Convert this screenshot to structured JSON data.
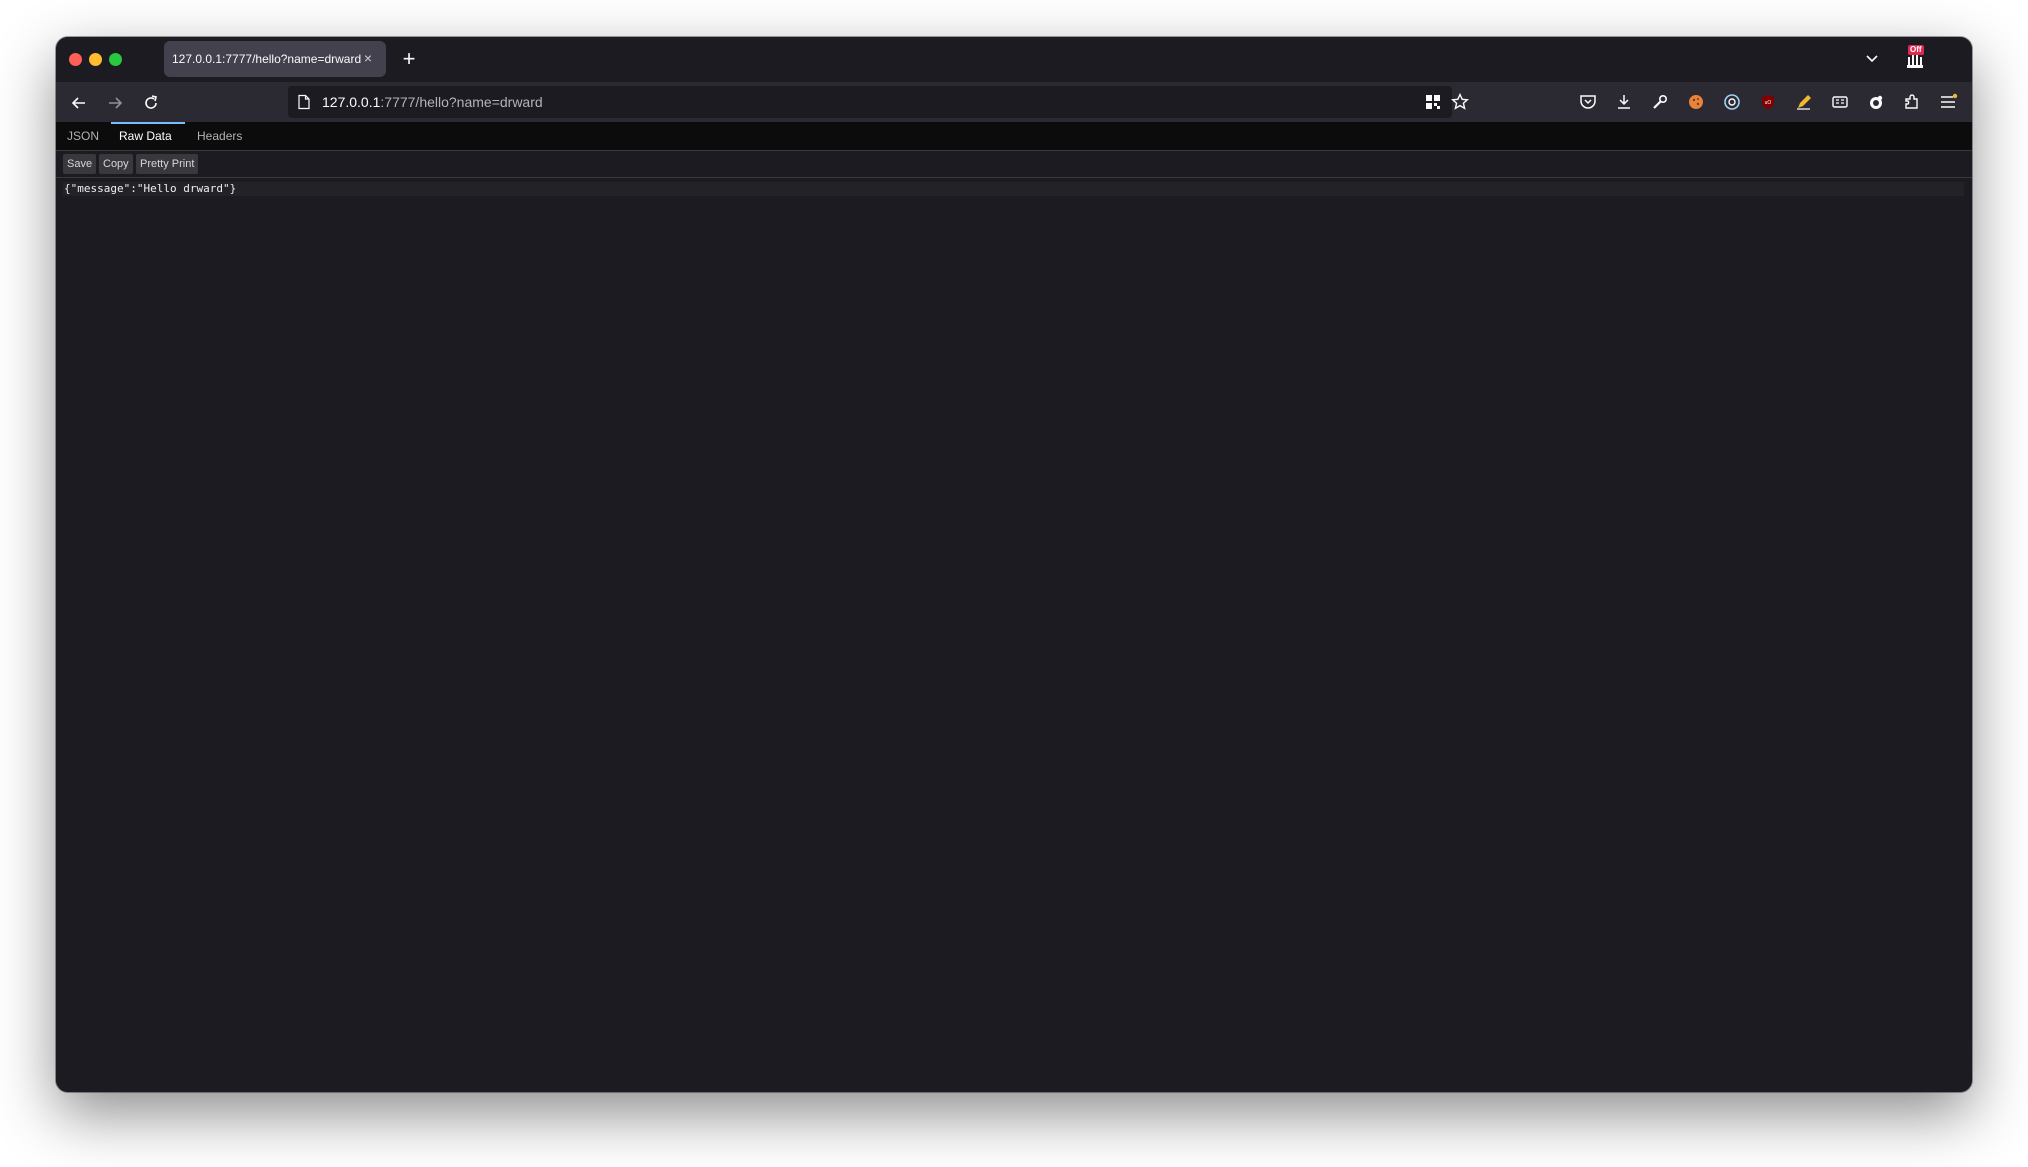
{
  "browser": {
    "tab": {
      "title": "127.0.0.1:7777/hello?name=drward",
      "close_glyph": "×"
    },
    "new_tab_glyph": "+",
    "extension_badge": "Off",
    "url": {
      "host": "127.0.0.1",
      "rest": ":7777/hello?name=drward"
    },
    "icons": [
      "back-icon",
      "forward-icon",
      "reload-icon",
      "page-icon",
      "qr-code-icon",
      "bookmark-star-icon",
      "pocket-icon",
      "downloads-icon",
      "wrench-icon",
      "cookie-icon",
      "globe-icon",
      "ublock-icon",
      "pen-icon",
      "reader-icon",
      "extension-circle-icon",
      "extensions-icon",
      "menu-icon",
      "chevron-down-icon"
    ]
  },
  "viewer": {
    "tabs": [
      {
        "label": "JSON"
      },
      {
        "label": "Raw Data"
      },
      {
        "label": "Headers"
      }
    ],
    "active_tab": "Raw Data",
    "buttons": {
      "save": "Save",
      "copy": "Copy",
      "pretty_print": "Pretty Print"
    },
    "raw_text": "{\"message\":\"Hello drward\"}"
  },
  "colors": {
    "window_bg": "#1c1b22",
    "toolbar_bg": "#2b2a33",
    "active_tab_accent": "#75bfff",
    "close_light": "#fe5f57",
    "minimize_light": "#febc2e",
    "maximize_light": "#28c840"
  }
}
